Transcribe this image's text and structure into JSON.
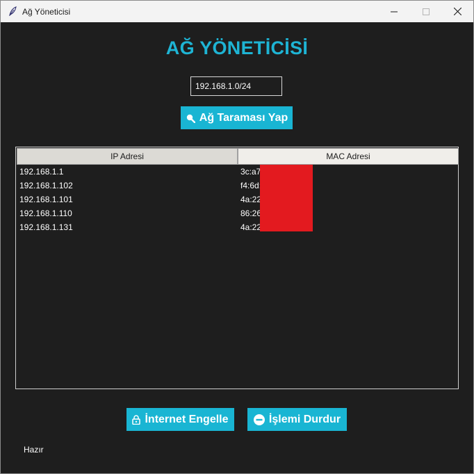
{
  "window": {
    "title": "Ağ Yöneticisi"
  },
  "app": {
    "title": "AĞ YÖNETİCİSİ"
  },
  "scan": {
    "range_value": "192.168.1.0/24",
    "button_label": "Ağ Taraması Yap"
  },
  "table": {
    "columns": [
      "IP Adresi",
      "MAC Adresi"
    ],
    "rows": [
      {
        "ip": "192.168.1.1",
        "mac": "3c:a7"
      },
      {
        "ip": "192.168.1.102",
        "mac": "f4:6d:"
      },
      {
        "ip": "192.168.1.101",
        "mac": "4a:22"
      },
      {
        "ip": "192.168.1.110",
        "mac": "86:26"
      },
      {
        "ip": "192.168.1.131",
        "mac": "4a:22"
      }
    ]
  },
  "actions": {
    "block_label": "İnternet Engelle",
    "stop_label": "İşlemi Durdur"
  },
  "status": {
    "text": "Hazır"
  },
  "colors": {
    "accent": "#19b5d3",
    "background": "#1e1e1e",
    "redaction": "#e31a1f"
  },
  "icons": {
    "scan": "search-icon",
    "block": "lock-icon",
    "stop": "stop-icon"
  }
}
